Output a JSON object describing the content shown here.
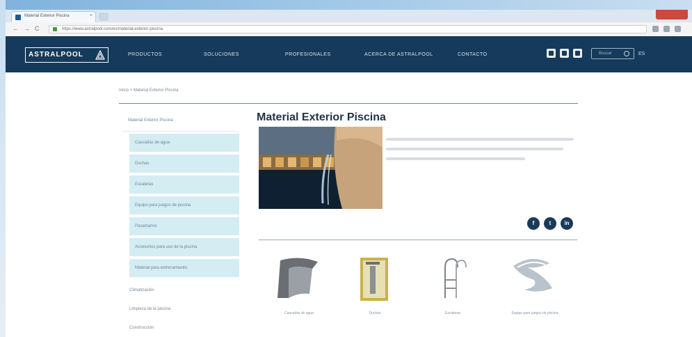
{
  "browser": {
    "tab_title": "Material Exterior Piscina",
    "tab_close": "×",
    "url": "https://www.astralpool.com/es/material-exterior-piscina",
    "nav_back": "←",
    "nav_forward": "→",
    "nav_reload": "C"
  },
  "header": {
    "logo_text": "ASTRALPOOL",
    "menu": [
      "PRODUCTOS",
      "SOLUCIONES",
      "PROFESIONALES",
      "ACERCA DE ASTRALPOOL",
      "CONTACTO"
    ],
    "search_placeholder": "Buscar",
    "lang": "ES"
  },
  "breadcrumb": "Inicio > Material Exterior Piscina",
  "sidebar": {
    "title": "Material Exterior Piscina",
    "items": [
      "Cascadas de agua",
      "Duchas",
      "Escaleras",
      "Equipo para juegos de piscina",
      "Pasamanos",
      "Accesorios para uso de la piscina",
      "Material para entrenamiento"
    ],
    "more": [
      "Climatización",
      "Limpieza de la piscina",
      "Construcción"
    ]
  },
  "main": {
    "title": "Material Exterior Piscina"
  },
  "social": [
    "f",
    "t",
    "in"
  ],
  "products": [
    {
      "name": "Cascadas de agua"
    },
    {
      "name": "Duchas"
    },
    {
      "name": "Escaleras"
    },
    {
      "name": "Equipo para juegos de piscina"
    }
  ],
  "colors": {
    "header": "#153a5b",
    "sidebar_item": "#d3edf3",
    "title": "#1f3345"
  }
}
